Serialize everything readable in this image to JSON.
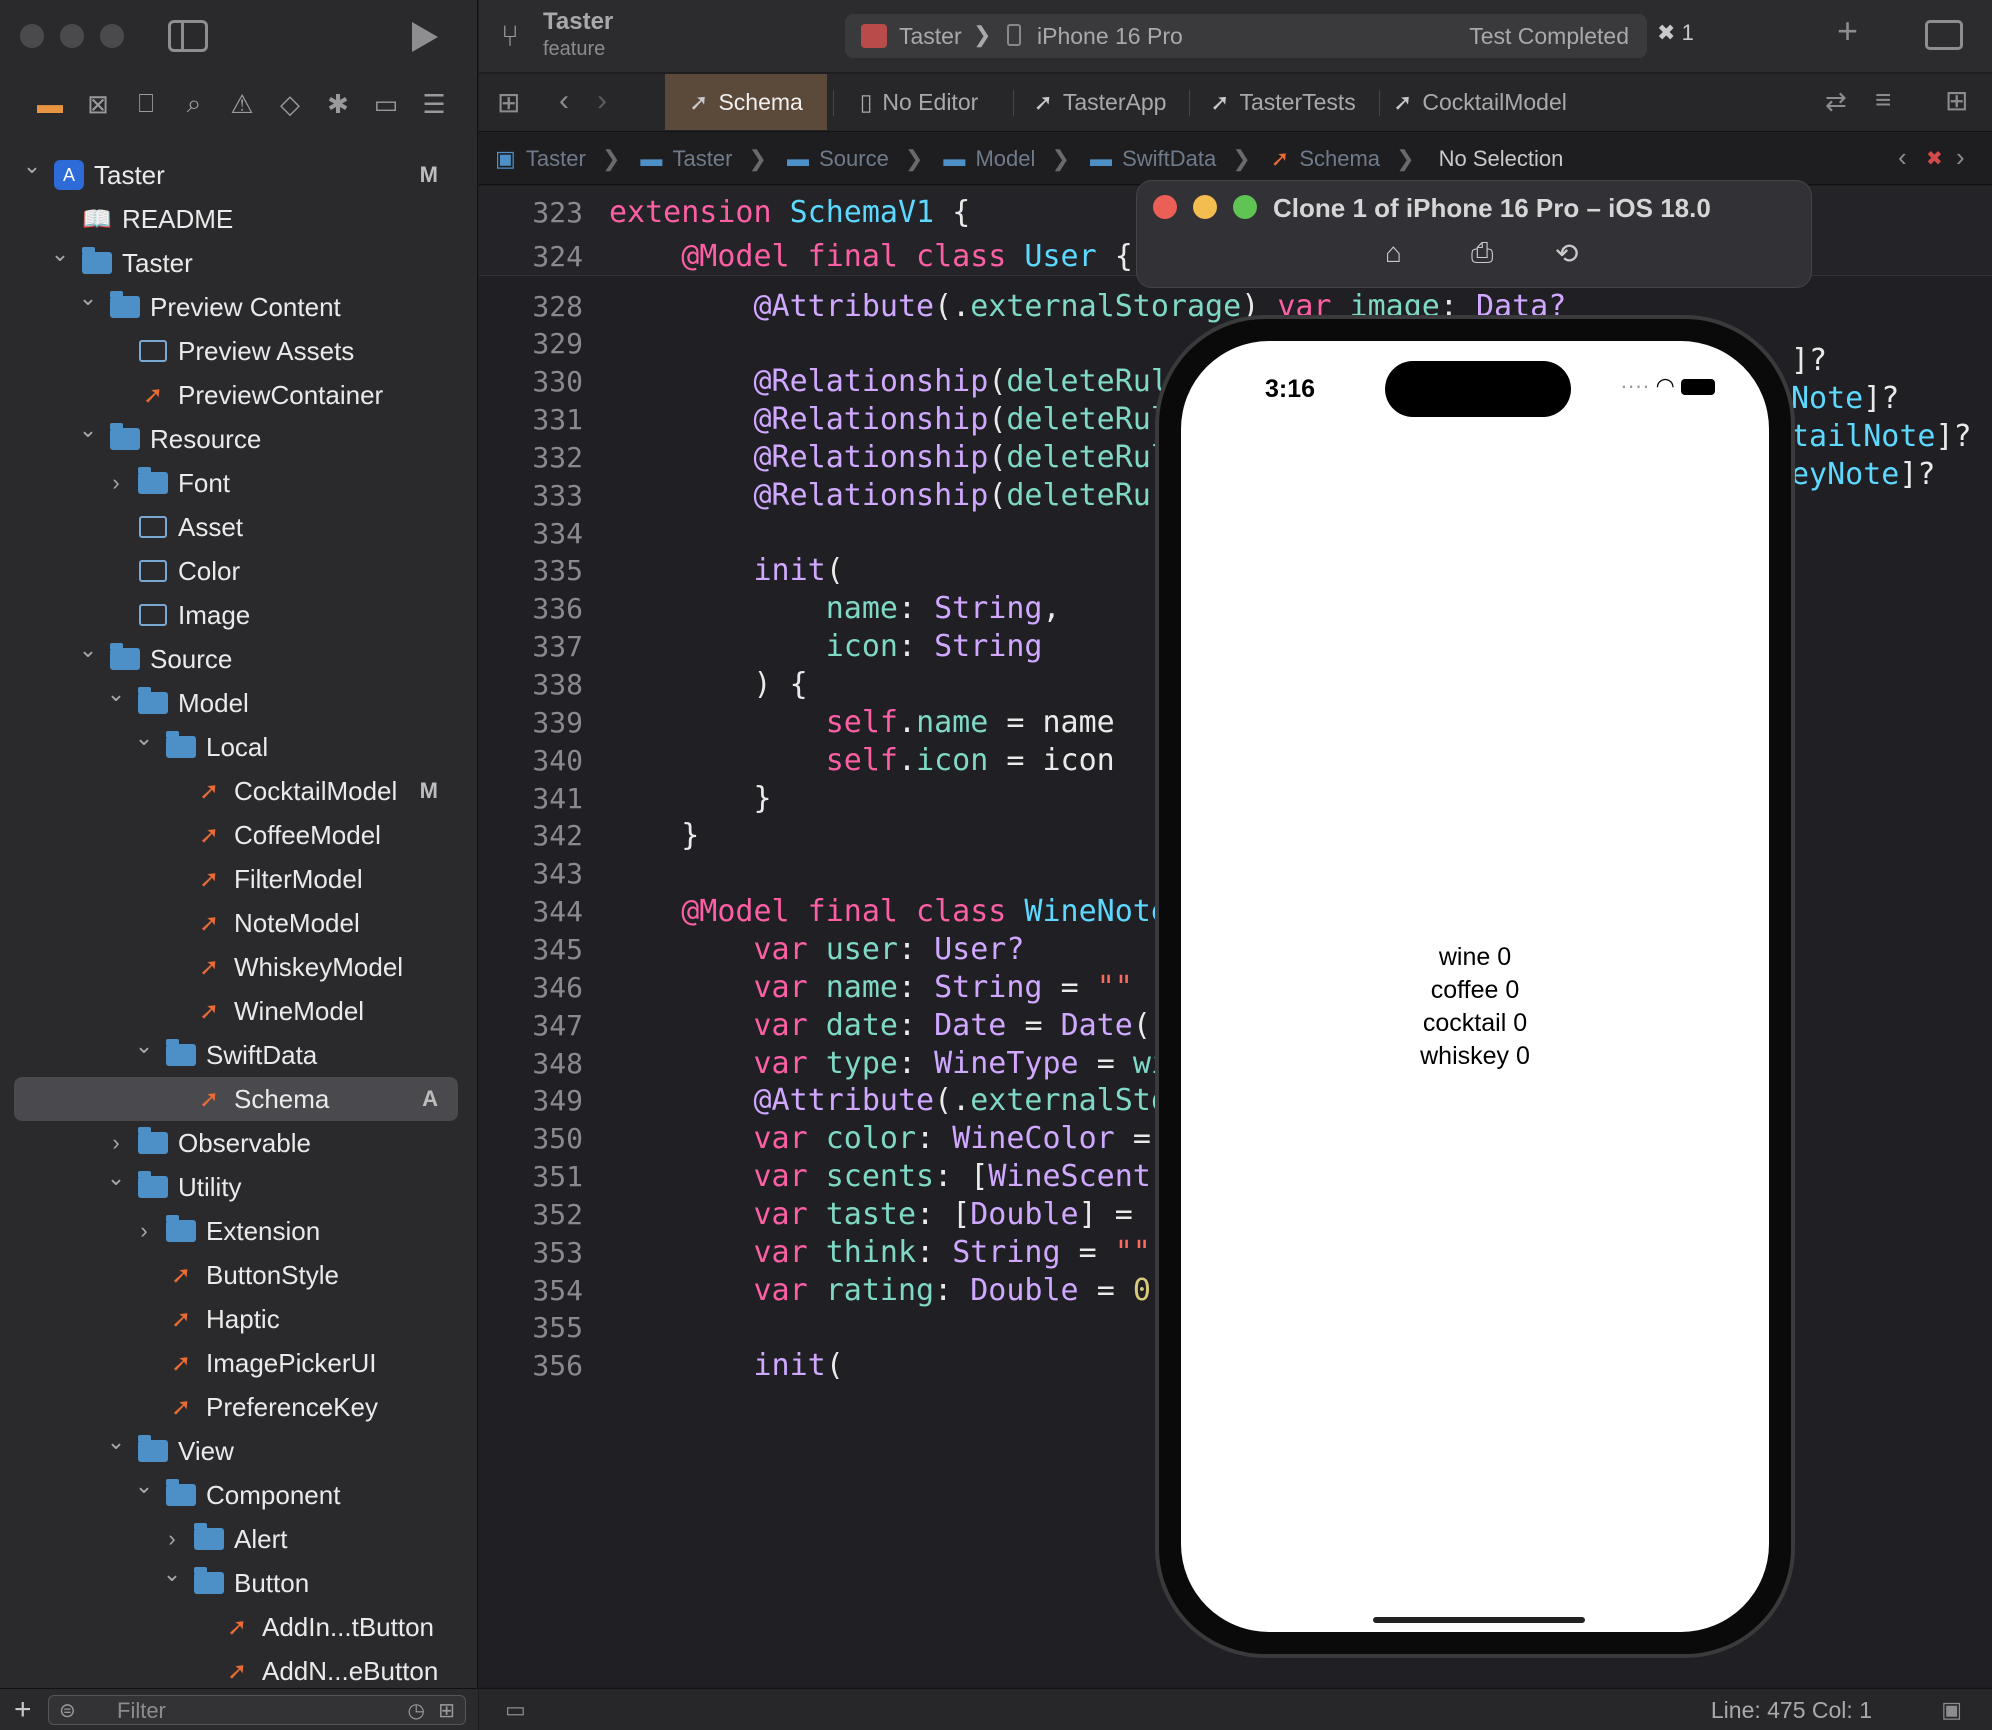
{
  "sidebar": {
    "filter_placeholder": "Filter",
    "tree": [
      {
        "label": "Taster",
        "icon": "app-icon",
        "chevron": "down",
        "level": 0,
        "badge": "M"
      },
      {
        "label": "README",
        "icon": "book-icon",
        "chevron": "",
        "level": 1,
        "badge": ""
      },
      {
        "label": "Taster",
        "icon": "folder-icon",
        "chevron": "down",
        "level": 1,
        "badge": ""
      },
      {
        "label": "Preview Content",
        "icon": "folder-icon",
        "chevron": "down",
        "level": 2,
        "badge": ""
      },
      {
        "label": "Preview Assets",
        "icon": "asset-icon",
        "chevron": "",
        "level": 3,
        "badge": ""
      },
      {
        "label": "PreviewContainer",
        "icon": "swift-icon",
        "chevron": "",
        "level": 3,
        "badge": ""
      },
      {
        "label": "Resource",
        "icon": "folder-icon",
        "chevron": "down",
        "level": 2,
        "badge": ""
      },
      {
        "label": "Font",
        "icon": "folder-icon",
        "chevron": "right",
        "level": 3,
        "badge": ""
      },
      {
        "label": "Asset",
        "icon": "asset-icon",
        "chevron": "",
        "level": 3,
        "badge": ""
      },
      {
        "label": "Color",
        "icon": "asset-icon",
        "chevron": "",
        "level": 3,
        "badge": ""
      },
      {
        "label": "Image",
        "icon": "asset-icon",
        "chevron": "",
        "level": 3,
        "badge": ""
      },
      {
        "label": "Source",
        "icon": "folder-icon",
        "chevron": "down",
        "level": 2,
        "badge": ""
      },
      {
        "label": "Model",
        "icon": "folder-icon",
        "chevron": "down",
        "level": 3,
        "badge": ""
      },
      {
        "label": "Local",
        "icon": "folder-icon",
        "chevron": "down",
        "level": 4,
        "badge": ""
      },
      {
        "label": "CocktailModel",
        "icon": "swift-icon",
        "chevron": "",
        "level": 5,
        "badge": "M"
      },
      {
        "label": "CoffeeModel",
        "icon": "swift-icon",
        "chevron": "",
        "level": 5,
        "badge": ""
      },
      {
        "label": "FilterModel",
        "icon": "swift-icon",
        "chevron": "",
        "level": 5,
        "badge": ""
      },
      {
        "label": "NoteModel",
        "icon": "swift-icon",
        "chevron": "",
        "level": 5,
        "badge": ""
      },
      {
        "label": "WhiskeyModel",
        "icon": "swift-icon",
        "chevron": "",
        "level": 5,
        "badge": ""
      },
      {
        "label": "WineModel",
        "icon": "swift-icon",
        "chevron": "",
        "level": 5,
        "badge": ""
      },
      {
        "label": "SwiftData",
        "icon": "folder-icon",
        "chevron": "down",
        "level": 4,
        "badge": ""
      },
      {
        "label": "Schema",
        "icon": "swift-icon",
        "chevron": "",
        "level": 5,
        "badge": "A",
        "selected": true
      },
      {
        "label": "Observable",
        "icon": "folder-icon",
        "chevron": "right",
        "level": 3,
        "badge": ""
      },
      {
        "label": "Utility",
        "icon": "folder-icon",
        "chevron": "down",
        "level": 3,
        "badge": ""
      },
      {
        "label": "Extension",
        "icon": "folder-icon",
        "chevron": "right",
        "level": 4,
        "badge": ""
      },
      {
        "label": "ButtonStyle",
        "icon": "swift-icon",
        "chevron": "",
        "level": 4,
        "badge": ""
      },
      {
        "label": "Haptic",
        "icon": "swift-icon",
        "chevron": "",
        "level": 4,
        "badge": ""
      },
      {
        "label": "ImagePickerUI",
        "icon": "swift-icon",
        "chevron": "",
        "level": 4,
        "badge": ""
      },
      {
        "label": "PreferenceKey",
        "icon": "swift-icon",
        "chevron": "",
        "level": 4,
        "badge": ""
      },
      {
        "label": "View",
        "icon": "folder-icon",
        "chevron": "down",
        "level": 3,
        "badge": ""
      },
      {
        "label": "Component",
        "icon": "folder-icon",
        "chevron": "down",
        "level": 4,
        "badge": ""
      },
      {
        "label": "Alert",
        "icon": "folder-icon",
        "chevron": "right",
        "level": 5,
        "badge": ""
      },
      {
        "label": "Button",
        "icon": "folder-icon",
        "chevron": "down",
        "level": 5,
        "badge": ""
      },
      {
        "label": "AddIn...tButton",
        "icon": "swift-icon",
        "chevron": "",
        "level": 6,
        "badge": ""
      },
      {
        "label": "AddN...eButton",
        "icon": "swift-icon",
        "chevron": "",
        "level": 6,
        "badge": ""
      }
    ]
  },
  "toolbar": {
    "project": "Taster",
    "branch": "feature",
    "scheme_target": "Taster",
    "scheme_device": "iPhone 16 Pro",
    "status": "Test Completed",
    "error_count": "1"
  },
  "tabs": [
    {
      "label": "Schema",
      "active": true
    },
    {
      "label": "No Editor",
      "active": false
    },
    {
      "label": "TasterApp",
      "active": false
    },
    {
      "label": "TasterTests",
      "active": false
    },
    {
      "label": "CocktailModel",
      "active": false
    }
  ],
  "breadcrumbs": [
    "Taster",
    "Taster",
    "Source",
    "Model",
    "SwiftData",
    "Schema",
    "No Selection"
  ],
  "code": {
    "sticky": [
      {
        "ln": "323",
        "html": "<span class=\"k\">extension</span> <span class=\"ty\">SchemaV1</span> <span class=\"w\">{</span>"
      },
      {
        "ln": "324",
        "html": "    <span class=\"k\">@Model final class</span> <span class=\"ty\">User</span> <span class=\"w\">{</span>"
      }
    ],
    "lines": [
      {
        "ln": "328",
        "html": "        <span class=\"a\">@Attribute</span><span class=\"w\">(.</span><span class=\"p\">externalStorage</span><span class=\"w\">)</span> <span class=\"k\">var</span> <span class=\"p\">image</span><span class=\"w\">:</span> <span class=\"t\">Data?</span>"
      },
      {
        "ln": "329",
        "html": ""
      },
      {
        "ln": "330",
        "html": "        <span class=\"a\">@Relationship</span><span class=\"w\">(</span><span class=\"p\">deleteRul</span>"
      },
      {
        "ln": "331",
        "html": "        <span class=\"a\">@Relationship</span><span class=\"w\">(</span><span class=\"p\">deleteRul</span>"
      },
      {
        "ln": "332",
        "html": "        <span class=\"a\">@Relationship</span><span class=\"w\">(</span><span class=\"p\">deleteRul</span>"
      },
      {
        "ln": "333",
        "html": "        <span class=\"a\">@Relationship</span><span class=\"w\">(</span><span class=\"p\">deleteRu</span>"
      },
      {
        "ln": "334",
        "html": ""
      },
      {
        "ln": "335",
        "html": "        <span class=\"t\">init</span><span class=\"w\">(</span>"
      },
      {
        "ln": "336",
        "html": "            <span class=\"p\">name</span><span class=\"w\">:</span> <span class=\"t\">String</span><span class=\"w\">,</span>"
      },
      {
        "ln": "337",
        "html": "            <span class=\"p\">icon</span><span class=\"w\">:</span> <span class=\"t\">String</span>"
      },
      {
        "ln": "338",
        "html": "        <span class=\"w\">) {</span>"
      },
      {
        "ln": "339",
        "html": "            <span class=\"k\">self</span><span class=\"w\">.</span><span class=\"p\">name</span> <span class=\"w\">= name</span>"
      },
      {
        "ln": "340",
        "html": "            <span class=\"k\">self</span><span class=\"w\">.</span><span class=\"p\">icon</span> <span class=\"w\">= icon</span>"
      },
      {
        "ln": "341",
        "html": "        <span class=\"w\">}</span>"
      },
      {
        "ln": "342",
        "html": "    <span class=\"w\">}</span>"
      },
      {
        "ln": "343",
        "html": ""
      },
      {
        "ln": "344",
        "html": "    <span class=\"k\">@Model final class</span> <span class=\"ty\">WineNote</span>"
      },
      {
        "ln": "345",
        "html": "        <span class=\"k\">var</span> <span class=\"p\">user</span><span class=\"w\">:</span> <span class=\"t\">User?</span>"
      },
      {
        "ln": "346",
        "html": "        <span class=\"k\">var</span> <span class=\"p\">name</span><span class=\"w\">:</span> <span class=\"t\">String</span> <span class=\"w\">=</span> <span class=\"s\">\"\"</span>"
      },
      {
        "ln": "347",
        "html": "        <span class=\"k\">var</span> <span class=\"p\">date</span><span class=\"w\">:</span> <span class=\"t\">Date</span> <span class=\"w\">=</span> <span class=\"t\">Date</span><span class=\"w\">()</span>"
      },
      {
        "ln": "348",
        "html": "        <span class=\"k\">var</span> <span class=\"p\">type</span><span class=\"w\">:</span> <span class=\"t\">WineType</span> <span class=\"w\">=</span> <span class=\"p\">wi</span>"
      },
      {
        "ln": "349",
        "html": "        <span class=\"a\">@Attribute</span><span class=\"w\">(.</span><span class=\"p\">externalSto</span>"
      },
      {
        "ln": "350",
        "html": "        <span class=\"k\">var</span> <span class=\"p\">color</span><span class=\"w\">:</span> <span class=\"t\">WineColor</span> <span class=\"w\">=</span>"
      },
      {
        "ln": "351",
        "html": "        <span class=\"k\">var</span> <span class=\"p\">scents</span><span class=\"w\">: [</span><span class=\"t\">WineScent</span><span class=\"w\">]</span>"
      },
      {
        "ln": "352",
        "html": "        <span class=\"k\">var</span> <span class=\"p\">taste</span><span class=\"w\">: [</span><span class=\"t\">Double</span><span class=\"w\">] = [</span>"
      },
      {
        "ln": "353",
        "html": "        <span class=\"k\">var</span> <span class=\"p\">think</span><span class=\"w\">:</span> <span class=\"t\">String</span> <span class=\"w\">=</span> <span class=\"s\">\"\"</span>"
      },
      {
        "ln": "354",
        "html": "        <span class=\"k\">var</span> <span class=\"p\">rating</span><span class=\"w\">:</span> <span class=\"t\">Double</span> <span class=\"w\">=</span> <span class=\"n\">0.</span>"
      },
      {
        "ln": "355",
        "html": ""
      },
      {
        "ln": "356",
        "html": "        <span class=\"t\">init</span><span class=\"w\">(</span>"
      }
    ],
    "overflow_right": [
      {
        "ln": "330",
        "html": "<span class=\"w\">]?</span>"
      },
      {
        "ln": "331",
        "html": "<span class=\"ty\">Note</span><span class=\"w\">]?</span>"
      },
      {
        "ln": "332",
        "html": "<span class=\"ty\">tailNote</span><span class=\"w\">]?</span>"
      },
      {
        "ln": "333",
        "html": "<span class=\"ty\">eyNote</span><span class=\"w\">]?</span>"
      }
    ]
  },
  "status_bar": {
    "position": "Line: 475  Col: 1"
  },
  "simulator": {
    "title": "Clone 1 of iPhone 16 Pro – iOS 18.0",
    "time": "3:16",
    "lines": [
      "wine 0",
      "coffee 0",
      "cocktail 0",
      "whiskey 0"
    ]
  }
}
